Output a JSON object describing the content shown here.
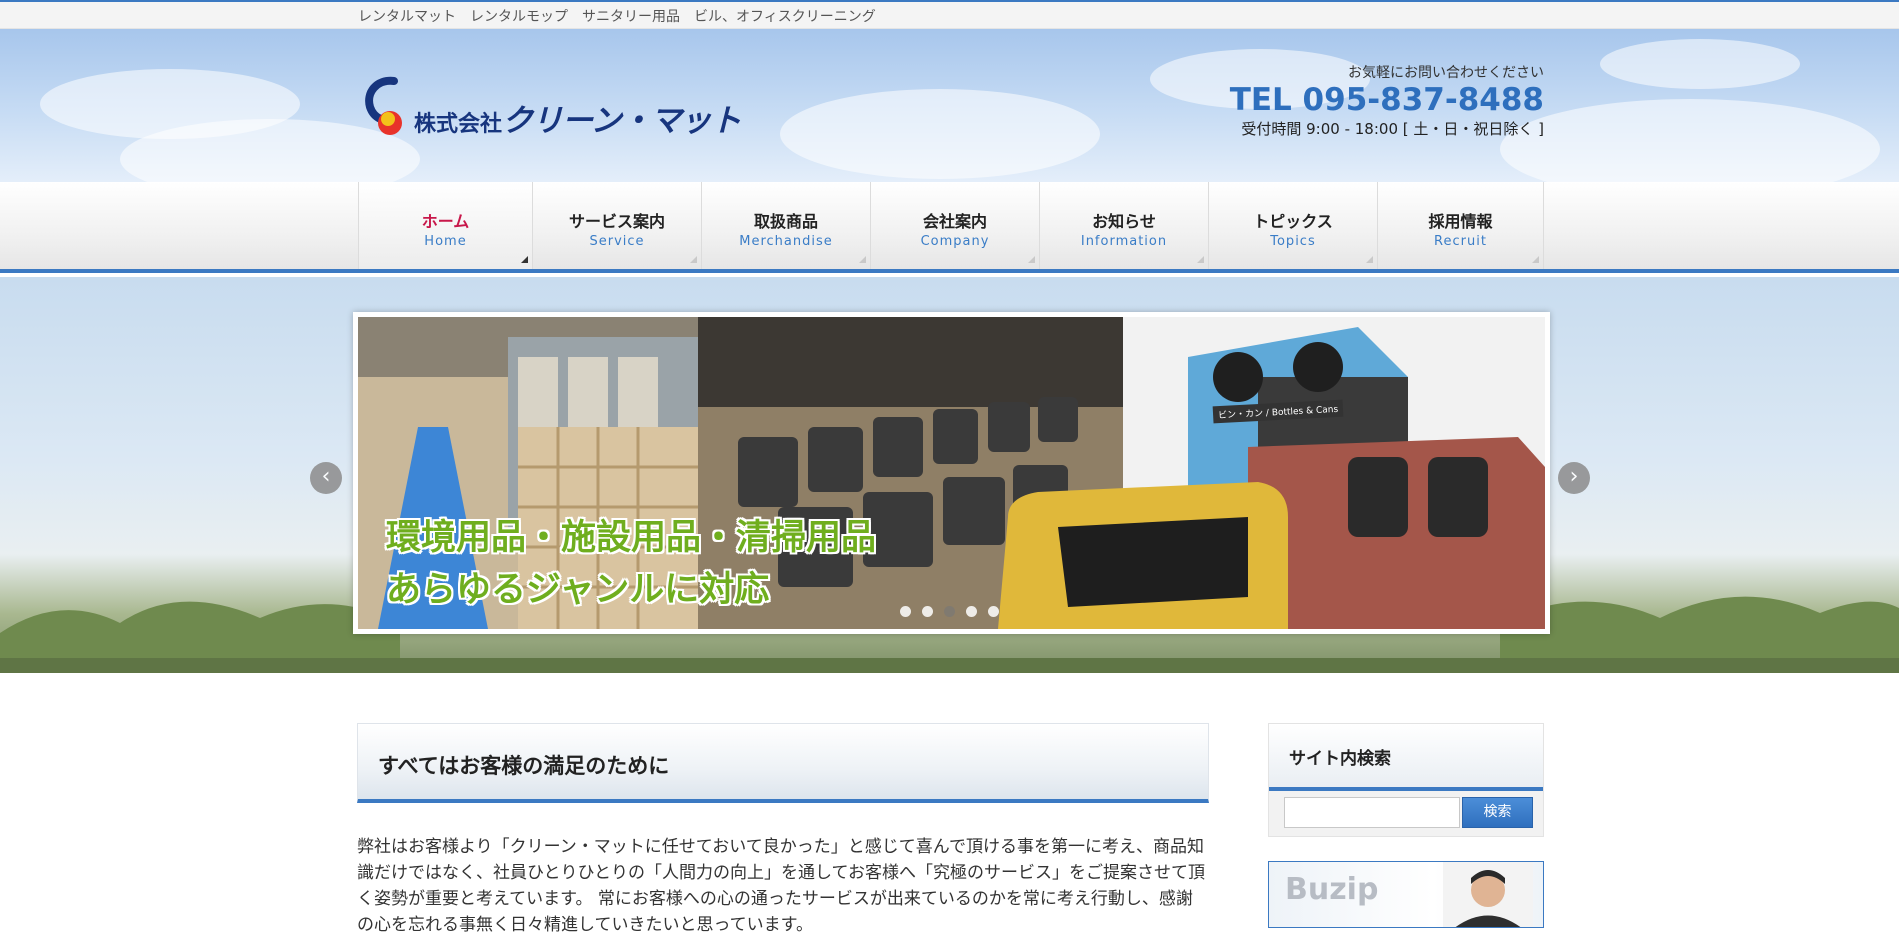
{
  "topbar": {
    "text": "レンタルマット　レンタルモップ　サニタリー用品　ビル、オフィスクリーニング"
  },
  "header": {
    "logo_text_small": "株式会社",
    "logo_text_main": "クリーン・マット",
    "contact_note": "お気軽にお問い合わせください",
    "tel": "TEL 095-837-8488",
    "hours": "受付時間 9:00 - 18:00 [ 土・日・祝日除く ]"
  },
  "nav": {
    "items": [
      {
        "jp": "ホーム",
        "en": "Home",
        "active": true
      },
      {
        "jp": "サービス案内",
        "en": "Service",
        "active": false
      },
      {
        "jp": "取扱商品",
        "en": "Merchandise",
        "active": false
      },
      {
        "jp": "会社案内",
        "en": "Company",
        "active": false
      },
      {
        "jp": "お知らせ",
        "en": "Information",
        "active": false
      },
      {
        "jp": "トピックス",
        "en": "Topics",
        "active": false
      },
      {
        "jp": "採用情報",
        "en": "Recruit",
        "active": false
      }
    ]
  },
  "slider": {
    "caption_line1": "環境用品・施設用品・清掃用品",
    "caption_line2": "あらゆるジャンルに対応",
    "bin_label": "ビン・カン / Bottles & Cans",
    "prev_label": "‹",
    "next_label": "›",
    "slide_count": 5,
    "active_index": 2
  },
  "main": {
    "title": "すべてはお客様の満足のために",
    "body": "弊社はお客様より「クリーン・マットに任せておいて良かった」と感じて喜んで頂ける事を第一に考え、商品知識だけではなく、社員ひとりひとりの「人間力の向上」を通してお客様へ「究極のサービス」をご提案させて頂く姿勢が重要と考えています。 常にお客様への心の通ったサービスが出来ているのかを常に考え行動し、感謝の心を忘れる事無く日々精進していきたいと思っています。"
  },
  "sidebar": {
    "search_title": "サイト内検索",
    "search_placeholder": "",
    "search_button": "検索",
    "banner_text": "Buzip"
  },
  "colors": {
    "accent": "#3b79c2",
    "active_nav": "#c8174a",
    "caption": "#6fae1e",
    "logo": "#17357e"
  }
}
